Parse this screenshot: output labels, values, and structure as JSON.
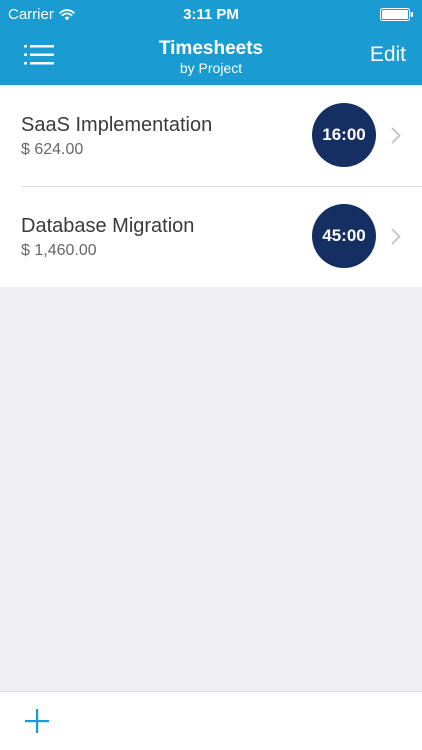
{
  "status_bar": {
    "carrier": "Carrier",
    "time": "3:11 PM",
    "icons": [
      "wifi-icon",
      "battery-icon"
    ]
  },
  "nav": {
    "title": "Timesheets",
    "subtitle": "by Project",
    "menu_icon": "hamburger-menu-icon",
    "edit_label": "Edit"
  },
  "projects": [
    {
      "name": "SaaS Implementation",
      "amount": "$ 624.00",
      "hours": "16:00"
    },
    {
      "name": "Database Migration",
      "amount": "$ 1,460.00",
      "hours": "45:00"
    }
  ],
  "toolbar": {
    "add_icon": "plus-icon"
  },
  "colors": {
    "header": "#1a9bd1",
    "badge": "#152f63",
    "accent": "#1a9bd1",
    "background": "#efeff4"
  }
}
